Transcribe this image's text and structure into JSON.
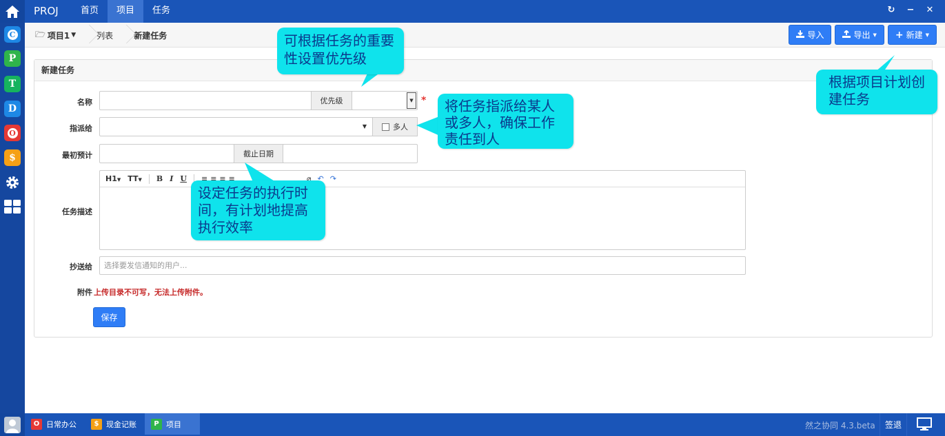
{
  "topbar": {
    "brand": "PROJ",
    "nav": [
      "首页",
      "项目",
      "任务"
    ],
    "active_index": 1
  },
  "leftbar": {
    "apps": [
      {
        "letter": "C",
        "color": "#1e88e5"
      },
      {
        "letter": "P",
        "color": "#2fb44b"
      },
      {
        "letter": "T",
        "color": "#16b35e"
      },
      {
        "letter": "D",
        "color": "#1e88e5"
      },
      {
        "letter": "O",
        "color": "#e53935"
      },
      {
        "letter": "$",
        "color": "#f5a015"
      }
    ]
  },
  "breadcrumb": {
    "project": "项目1",
    "list": "列表",
    "current": "新建任务"
  },
  "toolbar": {
    "import": "导入",
    "export": "导出",
    "create": "新建"
  },
  "panel": {
    "title": "新建任务"
  },
  "form": {
    "name_label": "名称",
    "priority_addon": "优先级",
    "required_mark": "*",
    "assign_label": "指派给",
    "multi_label": "多人",
    "estimate_label": "最初预计",
    "deadline_addon": "截止日期",
    "desc_label": "任务描述",
    "editor_tools": [
      "H1",
      "TT",
      "B",
      "I",
      "U"
    ],
    "cc_label": "抄送给",
    "cc_placeholder": "选择要发信通知的用户...",
    "attach_label": "附件",
    "attach_warning": "上传目录不可写，无法上传附件。",
    "save": "保存"
  },
  "callouts": {
    "priority": "可根据任务的重要性设置优先级",
    "assign": "将任务指派给某人或多人，确保工作责任到人",
    "deadline": "设定任务的执行时间，有计划地提高执行效率",
    "create": "根据项目计划创建任务"
  },
  "bottombar": {
    "tasks": [
      {
        "label": "日常办公",
        "color": "#e53935",
        "letter": "O"
      },
      {
        "label": "现金记账",
        "color": "#f5a015",
        "letter": "$"
      },
      {
        "label": "项目",
        "color": "#2fb44b",
        "letter": "P"
      }
    ],
    "version": "然之协同 4.3.beta",
    "logout": "签退"
  }
}
